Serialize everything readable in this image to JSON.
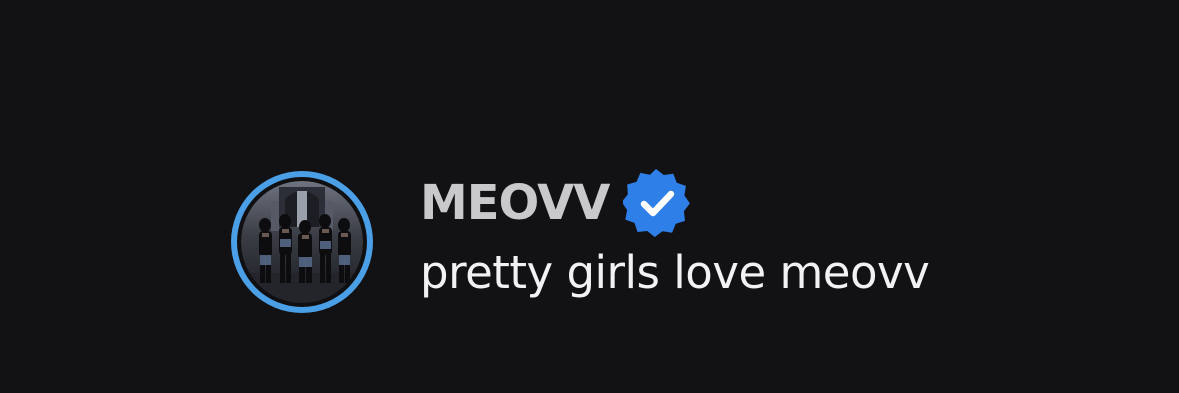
{
  "profile": {
    "display_name": "MEOVV",
    "bio": "pretty girls love meovv",
    "verified": true,
    "avatar_icon": "group-photo-avatar",
    "badge_icon": "verified-badge-icon"
  },
  "colors": {
    "background": "#121114",
    "avatar_ring": "#4a9fe6",
    "verified_badge": "#2f7fe8",
    "name_text": "#c9c9cc",
    "bio_text": "#f2f2f4"
  }
}
